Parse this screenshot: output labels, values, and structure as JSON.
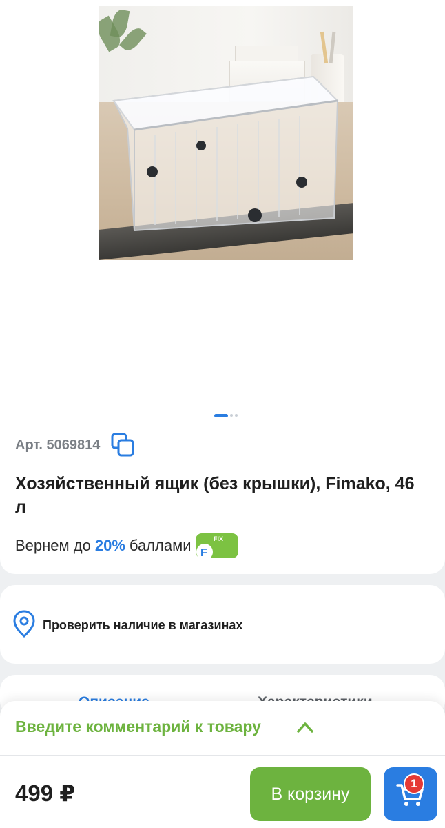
{
  "product": {
    "image_alt": "Прозрачный хозяйственный ящик на колёсах",
    "carousel": {
      "count": 3,
      "active": 0
    },
    "article_label": "Арт. 5069814",
    "title": "Хозяйственный ящик (без крышки), Fimako, 46 л",
    "bonus": {
      "prefix": "Вернем до",
      "percent": "20%",
      "suffix": "баллами",
      "badge_text": "FIX",
      "badge_letter": "F"
    }
  },
  "stores": {
    "check_label": "Проверить наличие в магазинах"
  },
  "tabs": {
    "description": "Описание",
    "specs": "Характеристики"
  },
  "comment": {
    "label": "Введите комментарий к товару"
  },
  "buy": {
    "price": "499 ₽",
    "cart_button": "В корзину",
    "cart_count": "1"
  },
  "colors": {
    "accent_green": "#6db33f",
    "accent_blue": "#2a7de1",
    "badge_red": "#e53935"
  }
}
